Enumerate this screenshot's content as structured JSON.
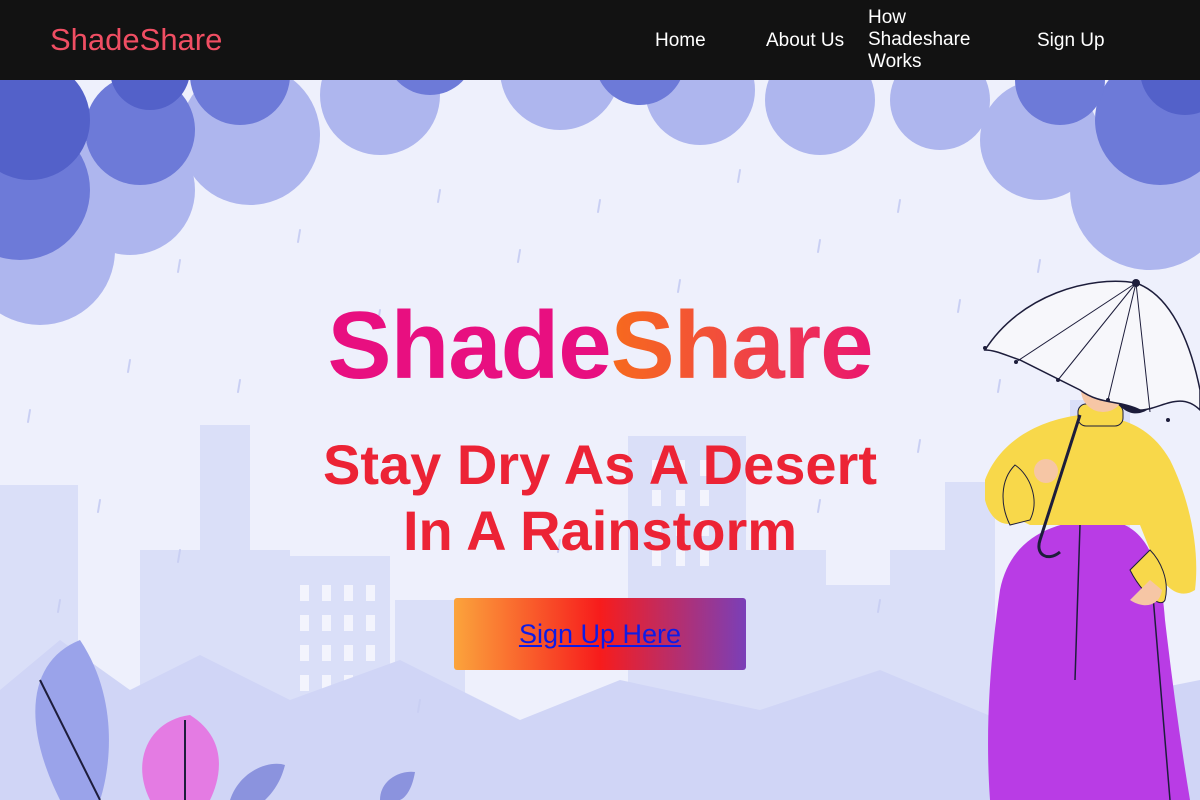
{
  "nav": {
    "logo": "ShadeShare",
    "links": [
      {
        "label": "Home"
      },
      {
        "label": "About Us"
      },
      {
        "label": "How Shadeshare Works"
      },
      {
        "label": "Sign Up"
      }
    ]
  },
  "hero": {
    "title_part1": "Shade",
    "title_part2": "Share",
    "tagline_line1": "Stay Dry As A Desert",
    "tagline_line2": "In A Rainstorm",
    "cta_label": "Sign Up Here"
  },
  "colors": {
    "navbar_bg": "#121212",
    "logo": "#f04e63",
    "title_pink": "#e80f80",
    "title_orange": "#f76a1d",
    "tagline": "#ec2335",
    "cta_gradient": [
      "#fba43c",
      "#f71c1c",
      "#7a3fb8"
    ],
    "link": "#0d1ce6"
  },
  "icons": [
    "cloud-icon",
    "umbrella-icon",
    "person-illustration",
    "leaf-icon",
    "city-skyline"
  ]
}
